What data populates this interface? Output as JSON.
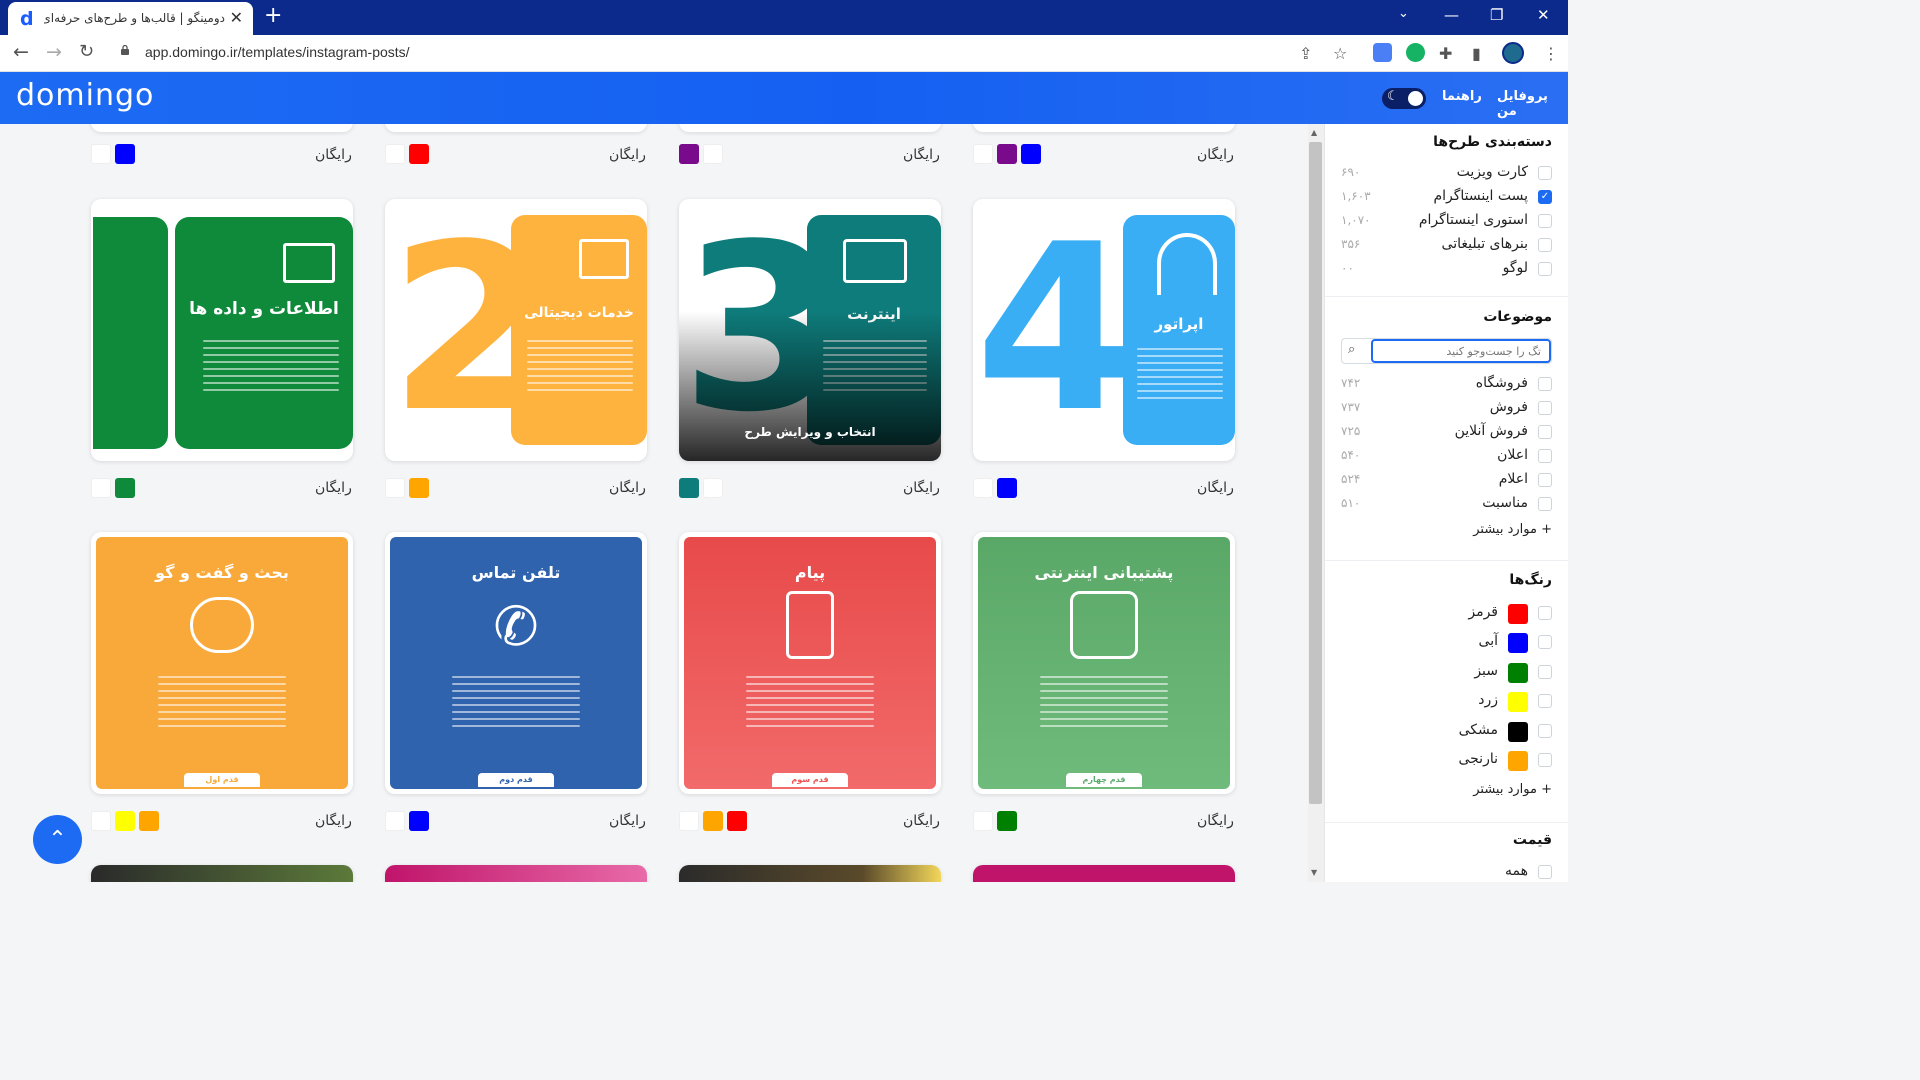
{
  "browser": {
    "tab_title": "دومینگو | قالب‌ها و طرح‌های حرفه‌ای",
    "favicon": "d",
    "url": "app.domingo.ir/templates/instagram-posts/"
  },
  "header": {
    "logo": "domingo",
    "profile_link": "پروفایل من",
    "help_link": "راهنما"
  },
  "price_label": "رایگان",
  "hover_action": "انتخاب و ویرایش طرح",
  "row_top_swatches": [
    [
      "#0000ff",
      "#ffffff"
    ],
    [
      "#ff0000",
      "#ffffff"
    ],
    [
      "#ffffff",
      "#7a0a8c"
    ],
    [
      "#0000ff",
      "#7a0a8c",
      "#ffffff"
    ]
  ],
  "cards_row1": [
    {
      "number": "1",
      "title": "اطلاعات و داده ها",
      "color": "#0e8a3a",
      "swatches": [
        "#0e8a3a",
        "#ffffff"
      ]
    },
    {
      "number": "2",
      "title": "خدمات دیجیتالی",
      "color": "#ffb33f",
      "swatches": [
        "#ffa500",
        "#ffffff"
      ]
    },
    {
      "number": "3",
      "title": "اینترنت",
      "color": "#0e7c7b",
      "swatches": [
        "#ffffff",
        "#0e7c7b"
      ]
    },
    {
      "number": "4",
      "title": "اپراتور",
      "color": "#39aef5",
      "swatches": [
        "#0000ff",
        "#ffffff"
      ]
    }
  ],
  "cards_row2": [
    {
      "title": "بحث و گفت و گو",
      "step": "قدم اول",
      "color": "#f9a93a",
      "swatches": [
        "#ffa500",
        "#ffff00",
        "#ffffff"
      ]
    },
    {
      "title": "تلفن تماس",
      "step": "قدم دوم",
      "color": "#2f63ae",
      "swatches": [
        "#0000ff",
        "#ffffff"
      ]
    },
    {
      "title": "پیام",
      "step": "قدم سوم",
      "color": "#ee5252",
      "swatches": [
        "#ff0000",
        "#ffa500",
        "#ffffff"
      ]
    },
    {
      "title": "پشتیبانی اینترنتی",
      "step": "قدم چهارم",
      "color": "#5caa6c",
      "swatches": [
        "#008000",
        "#ffffff"
      ]
    }
  ],
  "sidebar": {
    "categories_title": "دسته‌بندی طرح‌ها",
    "categories": [
      {
        "label": "کارت ویزیت",
        "count": "۶۹۰",
        "checked": false
      },
      {
        "label": "پست اینستاگرام",
        "count": "۱,۶۰۳",
        "checked": true
      },
      {
        "label": "استوری اینستاگرام",
        "count": "۱,۰۷۰",
        "checked": false
      },
      {
        "label": "بنرهای تبلیغاتی",
        "count": "۳۵۶",
        "checked": false
      },
      {
        "label": "لوگو",
        "count": "۰۰",
        "checked": false
      }
    ],
    "topics_title": "موضوعات",
    "topics_search_placeholder": "تگ را جست‌وجو کنید",
    "topics": [
      {
        "label": "فروشگاه",
        "count": "۷۴۲"
      },
      {
        "label": "فروش",
        "count": "۷۳۷"
      },
      {
        "label": "فروش آنلاین",
        "count": "۷۲۵"
      },
      {
        "label": "اعلان",
        "count": "۵۴۰"
      },
      {
        "label": "اعلام",
        "count": "۵۲۴"
      },
      {
        "label": "مناسبت",
        "count": "۵۱۰"
      }
    ],
    "more_label": "موارد بیشتر",
    "colors_title": "رنگ‌ها",
    "colors": [
      {
        "label": "قرمز",
        "hex": "#ff0000"
      },
      {
        "label": "آبی",
        "hex": "#0000ff"
      },
      {
        "label": "سبز",
        "hex": "#008000"
      },
      {
        "label": "زرد",
        "hex": "#ffff00"
      },
      {
        "label": "مشکی",
        "hex": "#000000"
      },
      {
        "label": "نارنجی",
        "hex": "#ffa500"
      }
    ],
    "price_title": "قیمت",
    "price_options": [
      {
        "label": "همه"
      }
    ]
  }
}
